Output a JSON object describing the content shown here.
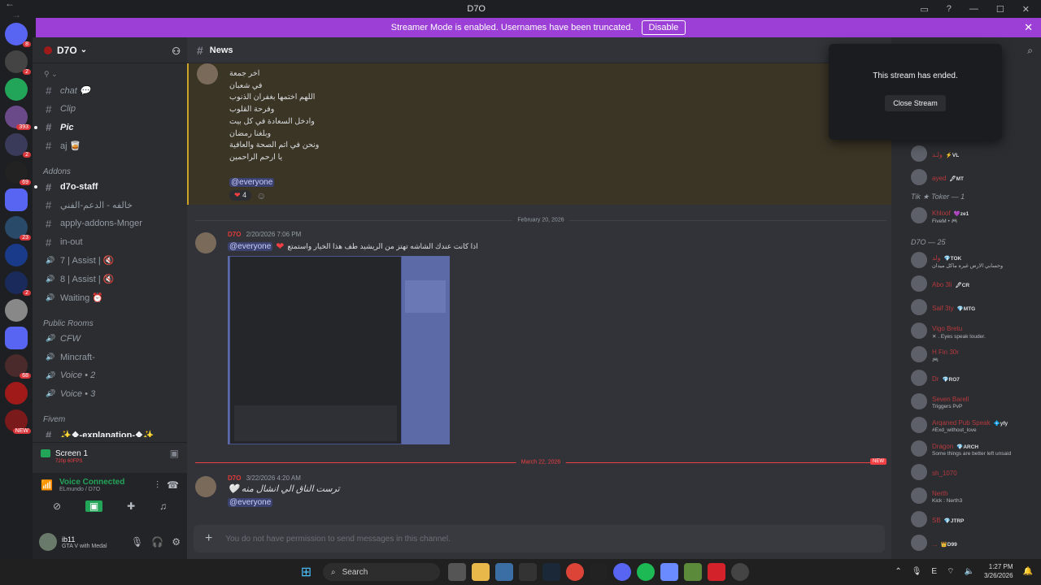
{
  "window": {
    "title": "D7O",
    "back": "←",
    "forward": "→",
    "controls": [
      "▭",
      "?",
      "—",
      "☐",
      "✕"
    ]
  },
  "streamer_banner": {
    "text": "Streamer Mode is enabled. Usernames have been truncated.",
    "button": "Disable",
    "close": "✕"
  },
  "guilds": [
    {
      "icon": "discord-home-icon",
      "color": "#5865f2",
      "badge": "8"
    },
    {
      "icon": "guild-icon",
      "color": "#444",
      "badge": "2"
    },
    {
      "icon": "guild-icon",
      "color": "#23a559",
      "badge": ""
    },
    {
      "icon": "guild-icon",
      "color": "#6b4a8a",
      "badge": "393"
    },
    {
      "icon": "guild-icon",
      "color": "#3a3a5a",
      "badge": "2"
    },
    {
      "icon": "guild-icon",
      "color": "#222",
      "badge": "69"
    },
    {
      "icon": "folder-icon",
      "color": "#5865f2",
      "badge": ""
    },
    {
      "icon": "guild-icon",
      "color": "#2a4a6a",
      "badge": "23"
    },
    {
      "icon": "guild-icon",
      "color": "#1a3a8a",
      "badge": ""
    },
    {
      "icon": "guild-icon",
      "color": "#1a2a5a",
      "badge": "2"
    },
    {
      "icon": "guild-icon",
      "color": "#888",
      "badge": ""
    },
    {
      "icon": "folder-icon",
      "color": "#5865f2",
      "badge": ""
    },
    {
      "icon": "guild-icon",
      "color": "#4a2a2a",
      "badge": "68"
    },
    {
      "icon": "guild-icon",
      "color": "#a01a1a",
      "badge": ""
    },
    {
      "icon": "guild-icon",
      "color": "#7a1a1a",
      "badge": "NEW"
    }
  ],
  "server": {
    "name": "D7O",
    "chevron": "⌄",
    "add_user_icon": "⚇"
  },
  "channels": {
    "top_collapsed": "⚲ ⌄",
    "group1": [
      {
        "type": "text",
        "name": "chat 💬",
        "bold": false,
        "italic": true
      },
      {
        "type": "text",
        "name": "Clip",
        "bold": false,
        "italic": true
      },
      {
        "type": "text",
        "name": "Pic",
        "bold": true,
        "italic": true,
        "unread": true
      },
      {
        "type": "text",
        "name": "aj 🥃",
        "bold": false,
        "italic": false
      }
    ],
    "addons_label": "Addons",
    "addons": [
      {
        "type": "text",
        "name": "d7o-staff",
        "bold": true,
        "unread": true
      },
      {
        "type": "text",
        "name": "خالفه - الدعم-الفني",
        "bold": false
      },
      {
        "type": "text",
        "name": "apply-addons-Mnger",
        "bold": false
      },
      {
        "type": "text",
        "name": "in-out",
        "bold": false
      },
      {
        "type": "voice",
        "name": "7 | Assist | 🔇",
        "bold": false
      },
      {
        "type": "voice",
        "name": "8 | Assist | 🔇",
        "bold": false
      },
      {
        "type": "voice",
        "name": "Waiting ⏰",
        "bold": false
      }
    ],
    "public_label": "Public Rooms",
    "public": [
      {
        "type": "voice",
        "name": "CFW",
        "bold": false,
        "italic": true
      },
      {
        "type": "voice",
        "name": "Mincraft-",
        "bold": false
      },
      {
        "type": "voice",
        "name": "Voice • 2",
        "bold": false,
        "italic": true
      },
      {
        "type": "voice",
        "name": "Voice • 3",
        "bold": false,
        "italic": true
      }
    ],
    "fivem_label": "Fivem",
    "fivem": [
      {
        "type": "text",
        "name": "✨❖-explanation-❖✨",
        "bold": true
      }
    ]
  },
  "screen": {
    "title": "Screen 1",
    "sub": "720p 60FPS"
  },
  "voice": {
    "status": "Voice Connected",
    "location": "ELmundo / D7O"
  },
  "user": {
    "name": "ib11",
    "status": "GTA V with Medal"
  },
  "channel_header": {
    "name": "News",
    "prefix": "#"
  },
  "messages": {
    "msg1_lines": [
      "اخر جمعة",
      "في شعبان",
      "اللهم اختمها بغفران الذنوب",
      "وفرحة القلوب",
      "وادخل السعادة في كل بيت",
      "وبلغنا رمضان",
      "ونحن في اتم الصحة والعافية",
      "يا ارحم الراحمين"
    ],
    "msg1_mention": "@everyone",
    "msg1_reaction_count": "4",
    "date_divider_1": "February 20, 2026",
    "msg2_name": "D7O",
    "msg2_time": "2/20/2026 7:06 PM",
    "msg2_mention": "@everyone",
    "msg2_text": "اذا كانت عندك الشاشه تهتز من الريشيد طف هذا الخيار واستمتع",
    "date_divider_2": "March 22, 2026",
    "new_badge": "NEW",
    "msg3_name": "D7O",
    "msg3_time": "3/22/2026 4:20 AM",
    "msg3_text": "ترست الناق الي انشال منه 🤍",
    "msg3_mention": "@everyone"
  },
  "composer": {
    "placeholder": "You do not have permission to send messages in this channel.",
    "plus": "+"
  },
  "stream_popup": {
    "text": "This stream has ended.",
    "button": "Close Stream"
  },
  "members": {
    "top": [
      {
        "name": "ولـد",
        "tag": "⚡VL",
        "sub": ""
      },
      {
        "name": "ayed",
        "tag": "🖋MT",
        "sub": ""
      }
    ],
    "group_tiktoker": "Tik ★ Toker — 1",
    "tiktoker": [
      {
        "name": "Khloof",
        "tag": "💜ze1",
        "sub": "FiveM • 🎮"
      }
    ],
    "group_d7o": "D7O — 25",
    "d7o": [
      {
        "name": "ولد",
        "tag": "💎TOK",
        "sub": "وحسابي الارض غيره ماكل ميدان"
      },
      {
        "name": "Abo 3li",
        "tag": "🖋CR",
        "sub": ""
      },
      {
        "name": "Saif 3ty",
        "tag": "💎MTG",
        "sub": ""
      },
      {
        "name": "Vigo Bretu",
        "tag": "",
        "sub": "✕ . Eyes speak louder."
      },
      {
        "name": "H Fin 30r",
        "tag": "",
        "sub": "🎮"
      },
      {
        "name": "Dr",
        "tag": "💎RO7",
        "sub": ""
      },
      {
        "name": "Seven Barell",
        "tag": "",
        "sub": "Triggers PvP"
      },
      {
        "name": "Arqaned Pub Speak",
        "tag": "💠yfy",
        "sub": "#Exd_without_love"
      },
      {
        "name": "Dragon",
        "tag": "💎ARCH",
        "sub": "Some things are better left unsaid"
      },
      {
        "name": "sh_1070",
        "tag": "",
        "sub": ""
      },
      {
        "name": "Nerth",
        "tag": "",
        "sub": "Kick : Nerth3"
      },
      {
        "name": "SB",
        "tag": "💎JTRP",
        "sub": ""
      },
      {
        "name": "...",
        "tag": "👑D99",
        "sub": ""
      }
    ]
  },
  "taskbar": {
    "search": "Search",
    "time": "1:27 PM",
    "date": "3/26/2026",
    "lang": "E"
  },
  "colors": {
    "accent": "#9b3fd6",
    "mention_bg": "#3c4270",
    "danger": "#f23f43"
  }
}
